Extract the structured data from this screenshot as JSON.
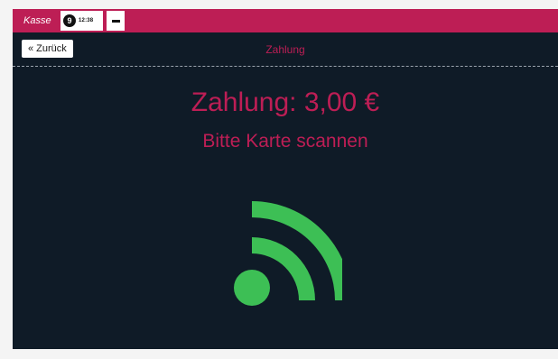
{
  "topbar": {
    "app_title": "Kasse",
    "badge_count": "9",
    "clock": "12:38",
    "colors": {
      "brand": "#bd1e55"
    }
  },
  "header": {
    "back_label": "« Zurück",
    "title": "Zahlung"
  },
  "main": {
    "amount_text": "Zahlung: 3,00 €",
    "instruction_text": "Bitte Karte scannen",
    "icon": "nfc-signal-icon",
    "colors": {
      "icon": "#3dbf55",
      "background": "#0f1b27"
    }
  }
}
